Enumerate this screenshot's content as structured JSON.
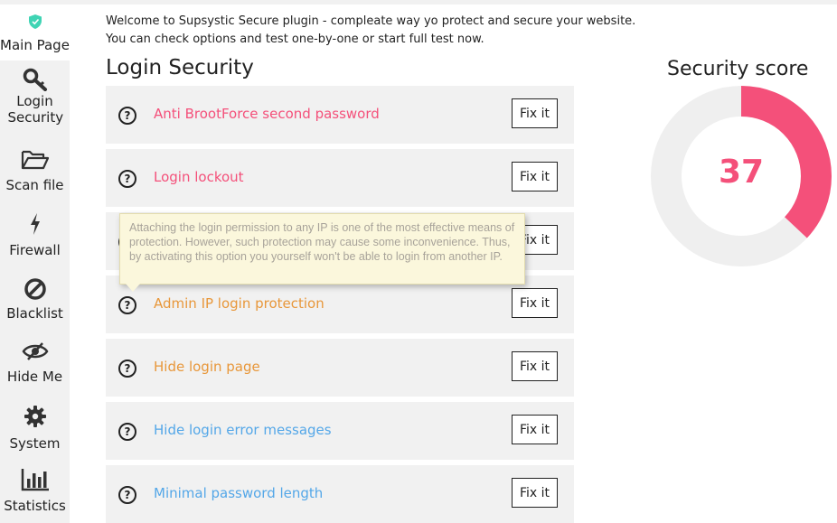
{
  "sidebar": {
    "items": [
      {
        "label": "Main Page",
        "icon": "shield-icon",
        "active": true
      },
      {
        "label": "Login Security",
        "icon": "key-icon"
      },
      {
        "label": "Scan file",
        "icon": "folder-open-icon"
      },
      {
        "label": "Firewall",
        "icon": "lightning-icon"
      },
      {
        "label": "Blacklist",
        "icon": "ban-icon"
      },
      {
        "label": "Hide Me",
        "icon": "eye-slash-icon"
      },
      {
        "label": "System",
        "icon": "gear-icon"
      },
      {
        "label": "Statistics",
        "icon": "bar-chart-icon"
      }
    ]
  },
  "intro": {
    "line1": "Welcome to Supsystic Secure plugin - compleate way yo protect and secure your website.",
    "line2": "You can check options and test one-by-one or start full test now."
  },
  "section": {
    "title": "Login Security"
  },
  "fix_label": "Fix it",
  "rows": [
    {
      "label": "Anti BrootForce second password",
      "color": "#f4507a"
    },
    {
      "label": "Login lockout",
      "color": "#f4507a"
    },
    {
      "label": "",
      "color": "#f4507a"
    },
    {
      "label": "Admin IP login protection",
      "color": "#e8973a"
    },
    {
      "label": "Hide login page",
      "color": "#e8973a"
    },
    {
      "label": "Hide login error messages",
      "color": "#54a7e8"
    },
    {
      "label": "Minimal password length",
      "color": "#54a7e8"
    }
  ],
  "tooltip": {
    "text": "Attaching the login permission to any IP is one of the most effective means of protection. However, such protection may cause some inconvenience. Thus, by activating this option you yourself won't be able to login from another IP."
  },
  "score": {
    "title": "Security score",
    "value": "37",
    "fraction": 0.37,
    "color": "#f4507a",
    "track_color": "#efefef"
  }
}
